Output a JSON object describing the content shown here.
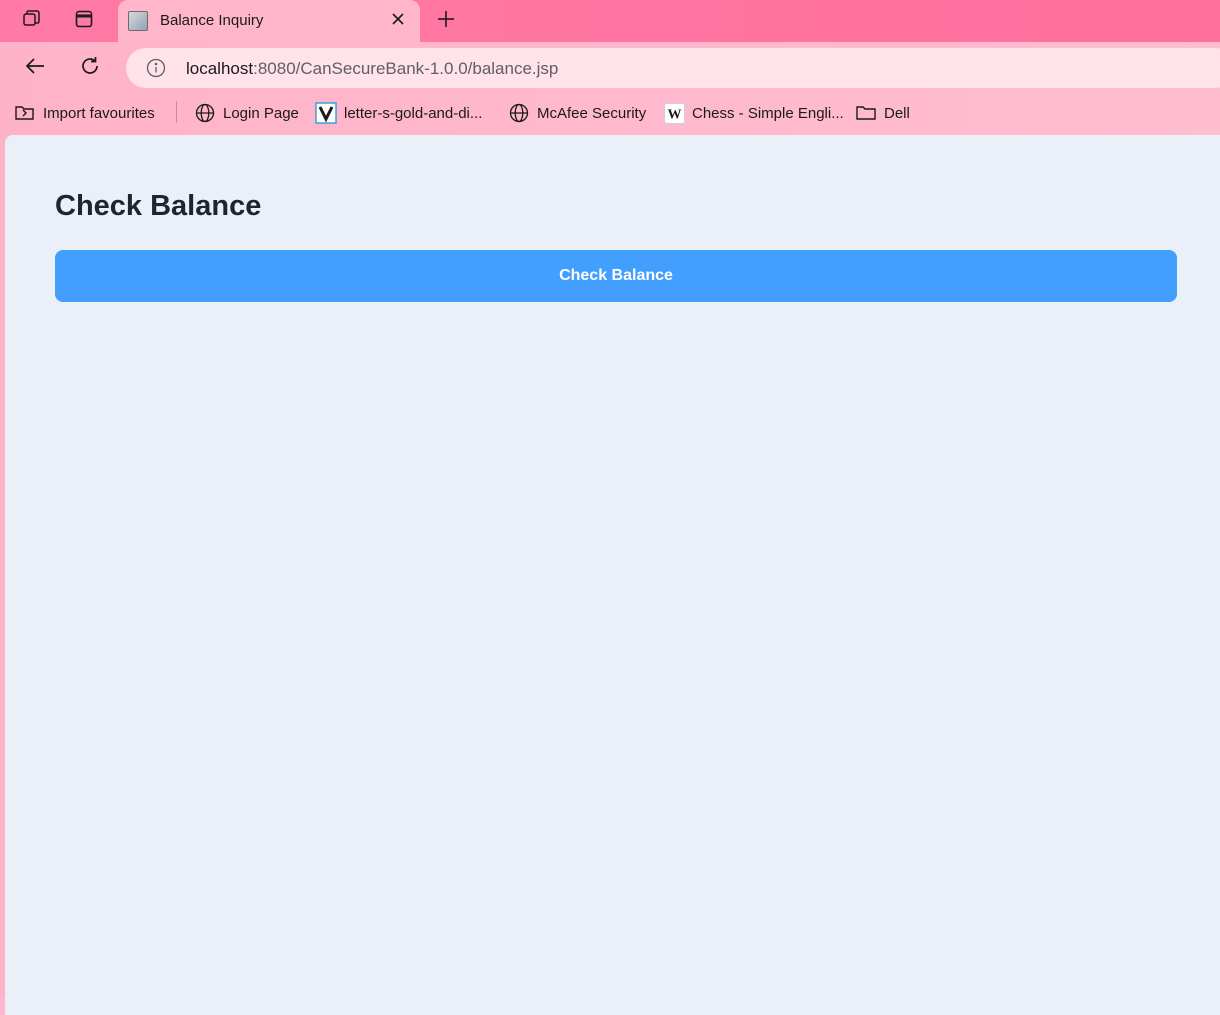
{
  "browser": {
    "tab": {
      "title": "Balance Inquiry"
    },
    "address": {
      "host": "localhost",
      "rest": ":8080/CanSecureBank-1.0.0/balance.jsp"
    },
    "bookmarks": [
      {
        "label": "Import favourites",
        "icon": "import-icon"
      },
      {
        "label": "Login Page",
        "icon": "globe-icon"
      },
      {
        "label": "letter-s-gold-and-di...",
        "icon": "v-logo-icon"
      },
      {
        "label": "McAfee Security",
        "icon": "globe-icon"
      },
      {
        "label": "Chess - Simple Engli...",
        "icon": "wikipedia-icon"
      },
      {
        "label": "Dell",
        "icon": "folder-icon"
      }
    ]
  },
  "page": {
    "heading": "Check Balance",
    "button_label": "Check Balance"
  },
  "colors": {
    "tab_strip": "#ff74a2",
    "toolbar": "#ffb8cd",
    "content_bg": "#ebeff7",
    "accent_button": "#429ffe",
    "heading_text": "#1e2430"
  }
}
